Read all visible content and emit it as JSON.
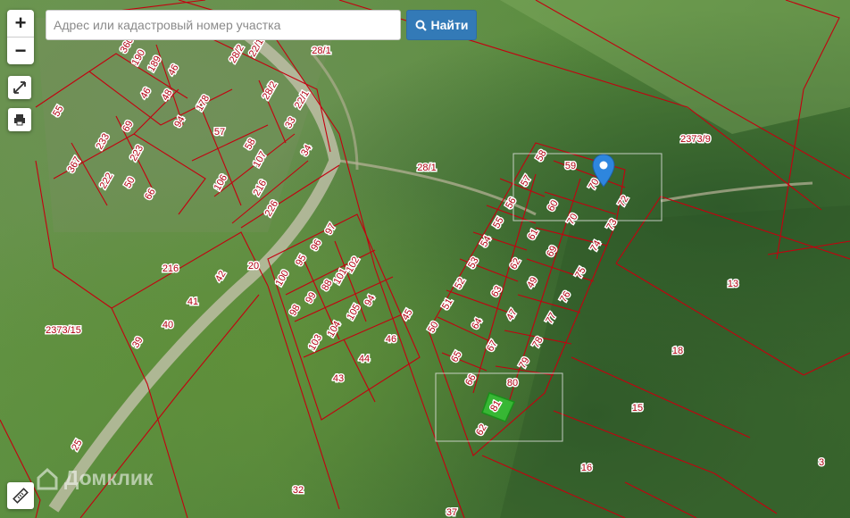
{
  "search": {
    "placeholder": "Адрес или кадастровый номер участка",
    "button_label": "Найти"
  },
  "controls": {
    "zoom_in": "+",
    "zoom_out": "−"
  },
  "watermark": "Домклик",
  "colors": {
    "parcel_border": "#c4000f",
    "button": "#337ab7",
    "marker": "#2e86de",
    "selected_parcel": "#35c335"
  },
  "parcels": [
    "22/1",
    "28/2",
    "28/1",
    "360",
    "190",
    "189",
    "46",
    "46",
    "48",
    "178",
    "94",
    "57",
    "55",
    "233",
    "69",
    "223",
    "367",
    "222",
    "50",
    "66",
    "58",
    "107",
    "106",
    "216",
    "226",
    "33",
    "22/1",
    "28/2",
    "34",
    "28/1",
    "2373/9",
    "58",
    "59",
    "70",
    "57",
    "56",
    "60",
    "70",
    "72",
    "55",
    "61",
    "73",
    "54",
    "69",
    "74",
    "53",
    "62",
    "75",
    "52",
    "49",
    "76",
    "51",
    "63",
    "77",
    "50",
    "64",
    "47",
    "78",
    "67",
    "65",
    "79",
    "66",
    "80",
    "81",
    "62",
    "97",
    "96",
    "102",
    "95",
    "101",
    "100",
    "88",
    "99",
    "94",
    "98",
    "105",
    "104",
    "103",
    "46",
    "44",
    "43",
    "45",
    "42",
    "20",
    "216",
    "41",
    "40",
    "39",
    "2373/15",
    "25",
    "32",
    "37",
    "13",
    "18",
    "15",
    "16",
    "3"
  ],
  "icons": [
    "fullscreen-icon",
    "print-icon",
    "ruler-icon",
    "search-icon",
    "map-marker-icon"
  ]
}
